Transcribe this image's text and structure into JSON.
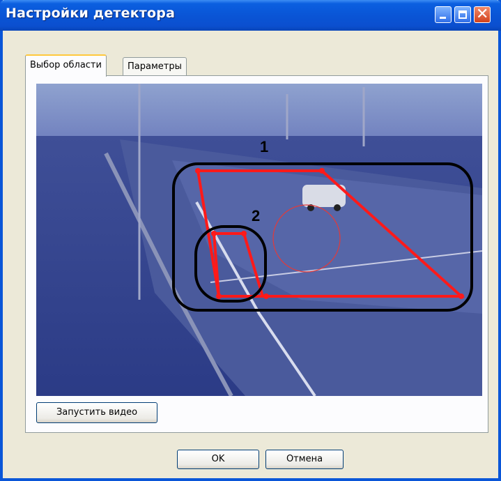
{
  "window": {
    "title": "Настройки детектора"
  },
  "titlebar_buttons": {
    "minimize_icon": "minimize-icon",
    "maximize_icon": "maximize-icon",
    "close_icon": "close-icon",
    "close_glyph": "✕"
  },
  "tabs": [
    {
      "label": "Выбор области",
      "active": true
    },
    {
      "label": "Параметры",
      "active": false
    }
  ],
  "video": {
    "zone_labels": [
      "1",
      "2"
    ]
  },
  "buttons": {
    "start_video": "Запустить видео",
    "ok": "OK",
    "cancel": "Отмена"
  },
  "colors": {
    "title_bar": "#0a55d6",
    "zone_outline": "#ff1a1a",
    "annotation": "#000000"
  }
}
